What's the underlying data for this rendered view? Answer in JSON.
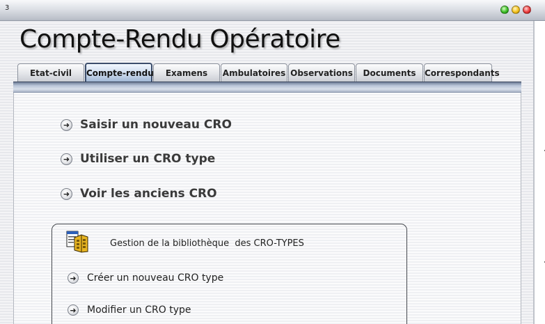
{
  "window": {
    "number": "3"
  },
  "page_title": "Compte-Rendu Opératoire",
  "tabs": [
    {
      "label": "Etat-civil"
    },
    {
      "label": "Compte-rendu"
    },
    {
      "label": "Examens"
    },
    {
      "label": "Ambulatoires"
    },
    {
      "label": "Observations"
    },
    {
      "label": "Documents"
    },
    {
      "label": "Correspondants"
    }
  ],
  "active_tab": "Compte-rendu",
  "actions": {
    "new_cro": "Saisir un nouveau CRO",
    "use_type": "Utiliser un CRO type",
    "view_old": "Voir les anciens CRO"
  },
  "library": {
    "title": "Gestion de la bibliothèque  des CRO-TYPES",
    "create": "Créer un nouveau CRO type",
    "modify": "Modifier un CRO type",
    "icon": "folder-document-icon"
  },
  "colors": {
    "active_tab_border": "#3c4e6c",
    "tab_strip": "#8391a8"
  }
}
